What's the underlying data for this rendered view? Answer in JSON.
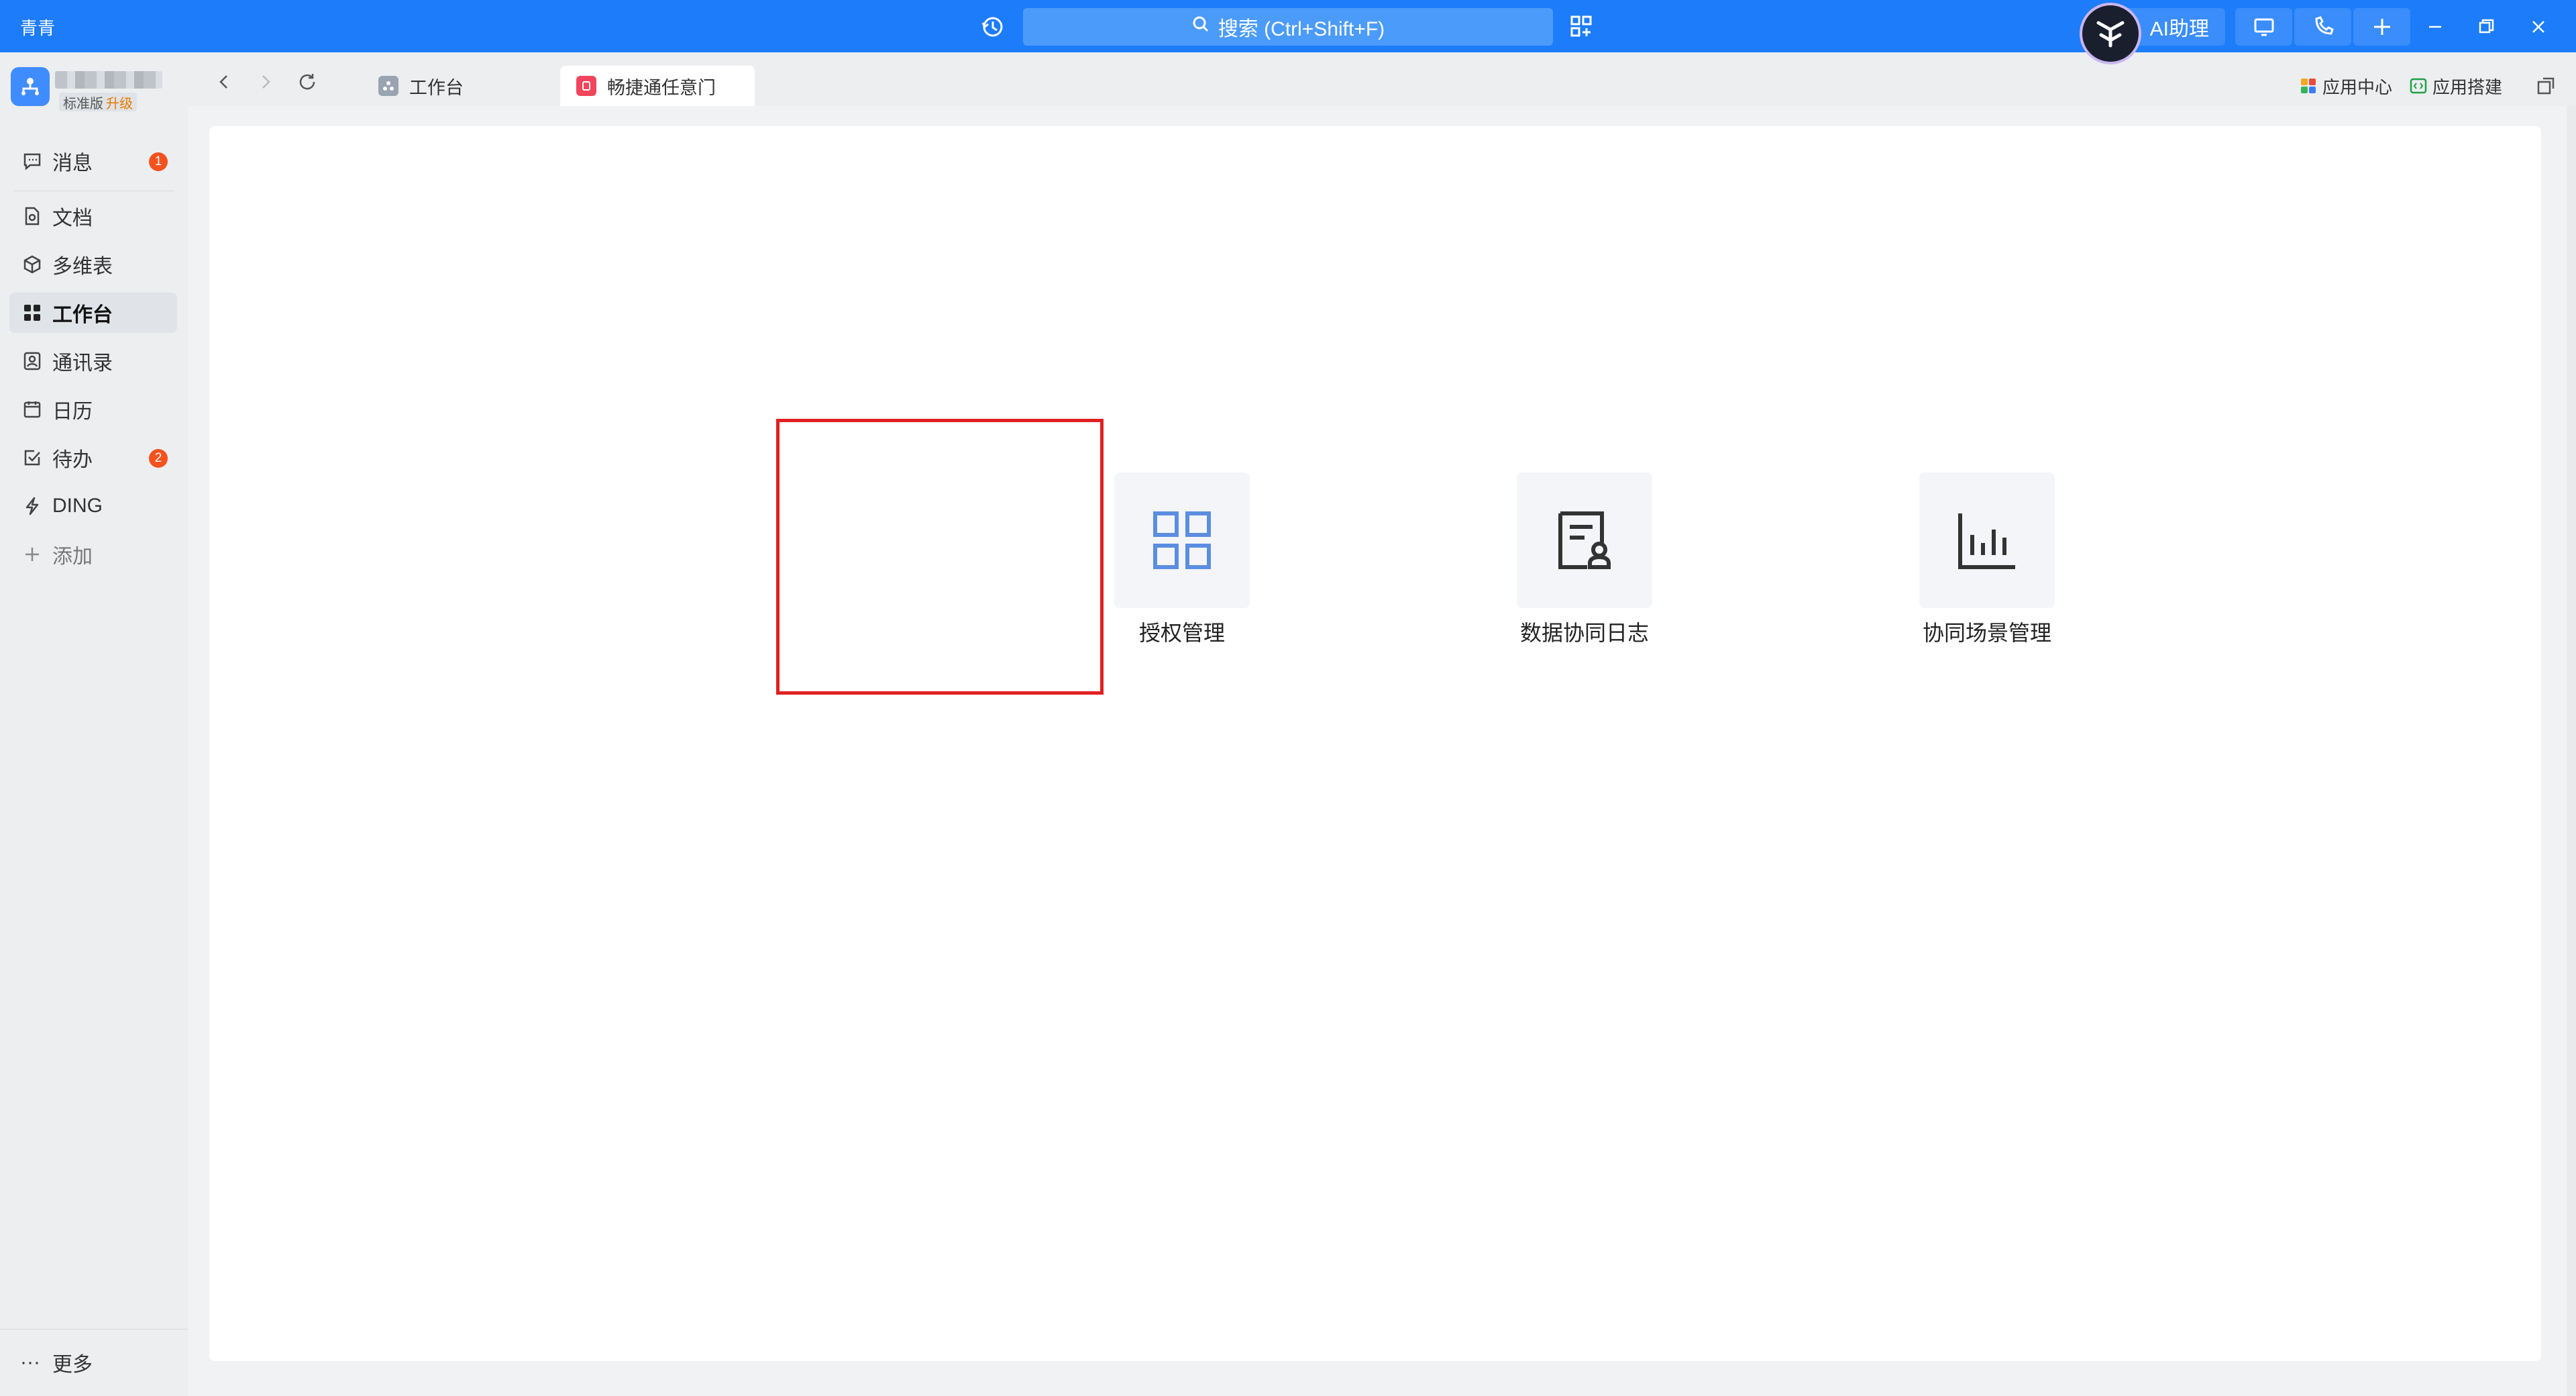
{
  "titlebar": {
    "brand": "青青",
    "search_placeholder": "搜索 (Ctrl+Shift+F)",
    "ai_label": "AI助理"
  },
  "sidebar": {
    "org_badge_plan": "标准版",
    "org_badge_upgrade": "升级",
    "items": [
      {
        "label": "消息",
        "badge": "1"
      },
      {
        "label": "文档"
      },
      {
        "label": "多维表"
      },
      {
        "label": "工作台"
      },
      {
        "label": "通讯录"
      },
      {
        "label": "日历"
      },
      {
        "label": "待办",
        "badge": "2"
      },
      {
        "label": "DING"
      },
      {
        "label": "添加"
      }
    ],
    "more_label": "更多"
  },
  "tabs": [
    {
      "label": "工作台"
    },
    {
      "label": "畅捷通任意门"
    }
  ],
  "toolbar": {
    "app_center": "应用中心",
    "app_builder": "应用搭建"
  },
  "apps": [
    {
      "label": "授权管理",
      "icon": "grid-icon"
    },
    {
      "label": "数据协同日志",
      "icon": "document-user-icon"
    },
    {
      "label": "协同场景管理",
      "icon": "bar-chart-icon"
    }
  ],
  "colors": {
    "titlebar": "#1c7cf9",
    "highlight": "#e02020",
    "accent_icon": "#5b8ee0",
    "badge": "#f4511e"
  }
}
